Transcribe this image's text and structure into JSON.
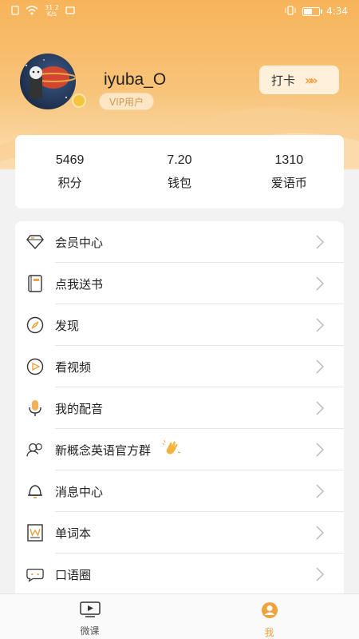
{
  "status_bar": {
    "net_speed_value": "31.2",
    "net_speed_unit": "K/s",
    "time": "4:34",
    "battery_level": 0.6
  },
  "profile": {
    "username": "iyuba_O",
    "vip_label": "VIP用户",
    "checkin_label": "打卡",
    "checkin_arrows": "»»"
  },
  "stats": [
    {
      "value": "5469",
      "label": "积分"
    },
    {
      "value": "7.20",
      "label": "钱包"
    },
    {
      "value": "1310",
      "label": "爱语币"
    }
  ],
  "menu": [
    {
      "label": "会员中心",
      "icon": "diamond-icon"
    },
    {
      "label": "点我送书",
      "icon": "book-icon"
    },
    {
      "label": "发现",
      "icon": "compass-icon"
    },
    {
      "label": "看视频",
      "icon": "video-play-icon"
    },
    {
      "label": "我的配音",
      "icon": "microphone-icon"
    },
    {
      "label": "新概念英语官方群",
      "icon": "group-icon"
    },
    {
      "label": "消息中心",
      "icon": "bell-icon"
    },
    {
      "label": "单词本",
      "icon": "wordbook-icon"
    },
    {
      "label": "口语圈",
      "icon": "chat-bubble-icon"
    }
  ],
  "bottom_nav": [
    {
      "label": "微课",
      "icon": "video-lesson-icon",
      "active": false
    },
    {
      "label": "我",
      "icon": "user-icon",
      "active": true
    }
  ],
  "colors": {
    "accent": "#f0a23c",
    "header_top": "#f7b45a",
    "header_bottom": "#fbe0b8"
  }
}
